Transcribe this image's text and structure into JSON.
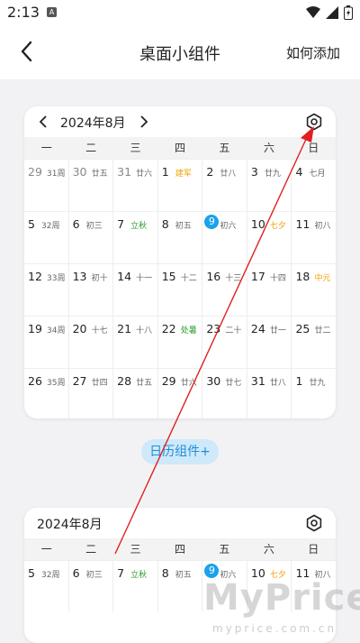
{
  "status": {
    "time": "2:13"
  },
  "header": {
    "title": "桌面小组件",
    "action": "如何添加"
  },
  "widget1": {
    "month": "2024年8月",
    "weekdays": [
      "一",
      "二",
      "三",
      "四",
      "五",
      "六",
      "日"
    ],
    "rows": [
      [
        {
          "d": "29",
          "l": "31周",
          "g": true
        },
        {
          "d": "30",
          "l": "廿五",
          "g": true
        },
        {
          "d": "31",
          "l": "廿六",
          "g": true
        },
        {
          "d": "1",
          "l": "建军",
          "c": "orange"
        },
        {
          "d": "2",
          "l": "廿八"
        },
        {
          "d": "3",
          "l": "廿九"
        },
        {
          "d": "4",
          "l": "七月"
        }
      ],
      [
        {
          "d": "5",
          "l": "32周"
        },
        {
          "d": "6",
          "l": "初三"
        },
        {
          "d": "7",
          "l": "立秋",
          "c": "green"
        },
        {
          "d": "8",
          "l": "初五"
        },
        {
          "d": "9",
          "l": "初六",
          "t": true
        },
        {
          "d": "10",
          "l": "七夕",
          "c": "orange"
        },
        {
          "d": "11",
          "l": "初八"
        }
      ],
      [
        {
          "d": "12",
          "l": "33周"
        },
        {
          "d": "13",
          "l": "初十"
        },
        {
          "d": "14",
          "l": "十一"
        },
        {
          "d": "15",
          "l": "十二"
        },
        {
          "d": "16",
          "l": "十三"
        },
        {
          "d": "17",
          "l": "十四"
        },
        {
          "d": "18",
          "l": "中元",
          "c": "orange"
        }
      ],
      [
        {
          "d": "19",
          "l": "34周"
        },
        {
          "d": "20",
          "l": "十七"
        },
        {
          "d": "21",
          "l": "十八"
        },
        {
          "d": "22",
          "l": "处暑",
          "c": "green"
        },
        {
          "d": "23",
          "l": "二十"
        },
        {
          "d": "24",
          "l": "廿一"
        },
        {
          "d": "25",
          "l": "廿二"
        }
      ],
      [
        {
          "d": "26",
          "l": "35周"
        },
        {
          "d": "27",
          "l": "廿四"
        },
        {
          "d": "28",
          "l": "廿五"
        },
        {
          "d": "29",
          "l": "廿六"
        },
        {
          "d": "30",
          "l": "廿七"
        },
        {
          "d": "31",
          "l": "廿八"
        },
        {
          "d": "1",
          "l": "廿九"
        }
      ]
    ]
  },
  "add_button": "日历组件+",
  "widget2": {
    "month": "2024年8月",
    "weekdays": [
      "一",
      "二",
      "三",
      "四",
      "五",
      "六",
      "日"
    ],
    "row": [
      {
        "d": "5",
        "l": "32周"
      },
      {
        "d": "6",
        "l": "初三"
      },
      {
        "d": "7",
        "l": "立秋",
        "c": "green"
      },
      {
        "d": "8",
        "l": "初五"
      },
      {
        "d": "9",
        "l": "初六",
        "t": true
      },
      {
        "d": "10",
        "l": "七夕",
        "c": "orange"
      },
      {
        "d": "11",
        "l": "初八"
      }
    ]
  },
  "watermark": {
    "main": "MyPrice",
    "sub": "myprice.com.cn"
  },
  "colors": {
    "accent": "#1ba2ea",
    "term_green": "#2a9d2a",
    "festival_orange": "#f2a100",
    "arrow_red": "#e02020"
  }
}
